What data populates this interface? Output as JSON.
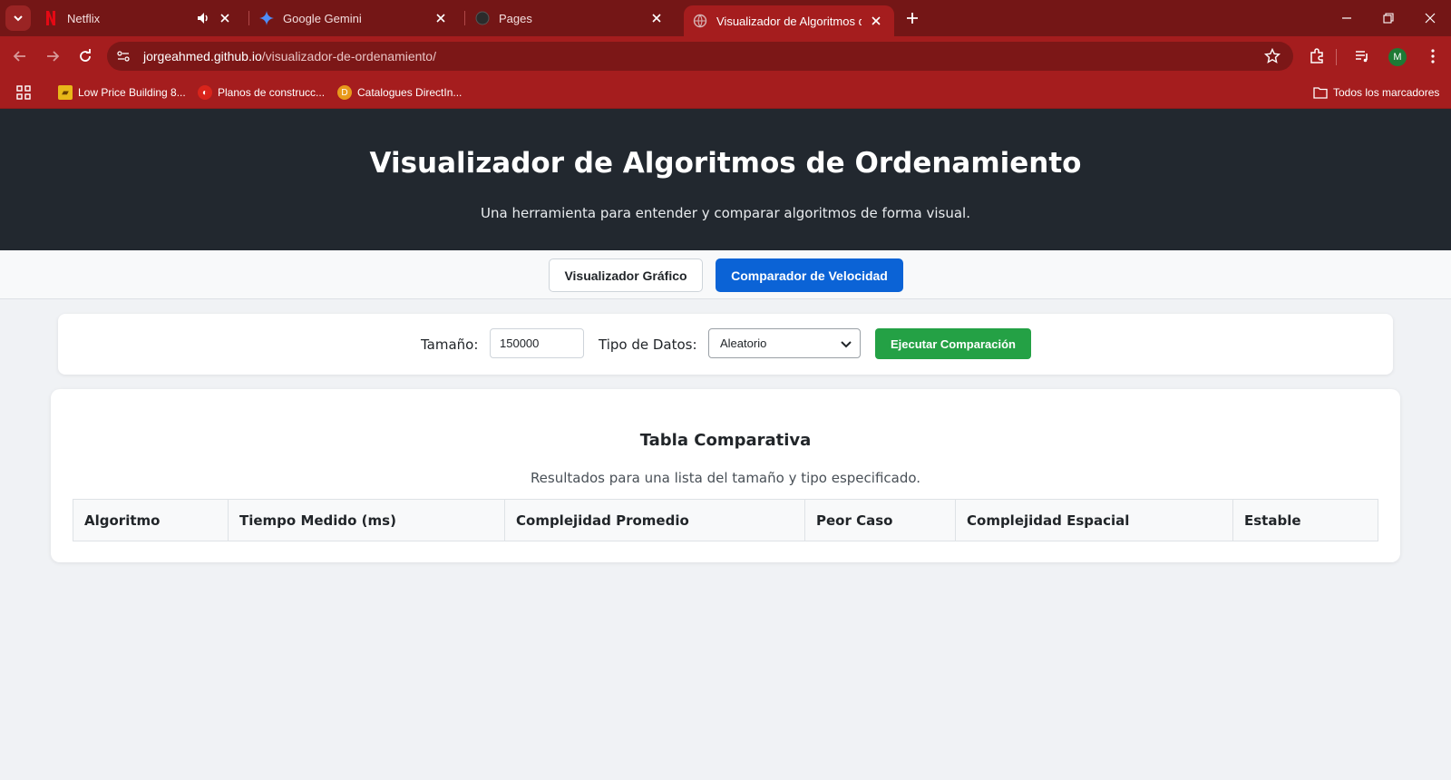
{
  "browser": {
    "tabs": [
      {
        "title": "Netflix",
        "icon": "netflix-icon",
        "audio": true
      },
      {
        "title": "Google Gemini",
        "icon": "gemini-icon"
      },
      {
        "title": "Pages",
        "icon": "github-icon"
      },
      {
        "title": "Visualizador de Algoritmos de O",
        "icon": "globe-icon",
        "active": true
      }
    ],
    "url_host": "jorgeahmed.github.io",
    "url_path": "/visualizador-de-ordenamiento/",
    "profile_initial": "M",
    "bookmarks": [
      {
        "label": "Low Price Building 8...",
        "icon": "folder-gold-icon"
      },
      {
        "label": "Planos de construcc...",
        "icon": "red-circle-icon"
      },
      {
        "label": "Catalogues DirectIn...",
        "icon": "d-circle-icon"
      }
    ],
    "all_bookmarks": "Todos los marcadores",
    "theme_color": "#a51d1e"
  },
  "header": {
    "title": "Visualizador de Algoritmos de Ordenamiento",
    "subtitle": "Una herramienta para entender y comparar algoritmos de forma visual."
  },
  "nav": {
    "tab_visual": "Visualizador Gráfico",
    "tab_speed": "Comparador de Velocidad"
  },
  "controls": {
    "size_label": "Tamaño:",
    "size_value": "150000",
    "type_label": "Tipo de Datos:",
    "type_value": "Aleatorio",
    "run_label": "Ejecutar Comparación"
  },
  "results": {
    "title": "Tabla Comparativa",
    "description": "Resultados para una lista del tamaño y tipo especificado.",
    "columns": [
      "Algoritmo",
      "Tiempo Medido (ms)",
      "Complejidad Promedio",
      "Peor Caso",
      "Complejidad Espacial",
      "Estable"
    ]
  }
}
